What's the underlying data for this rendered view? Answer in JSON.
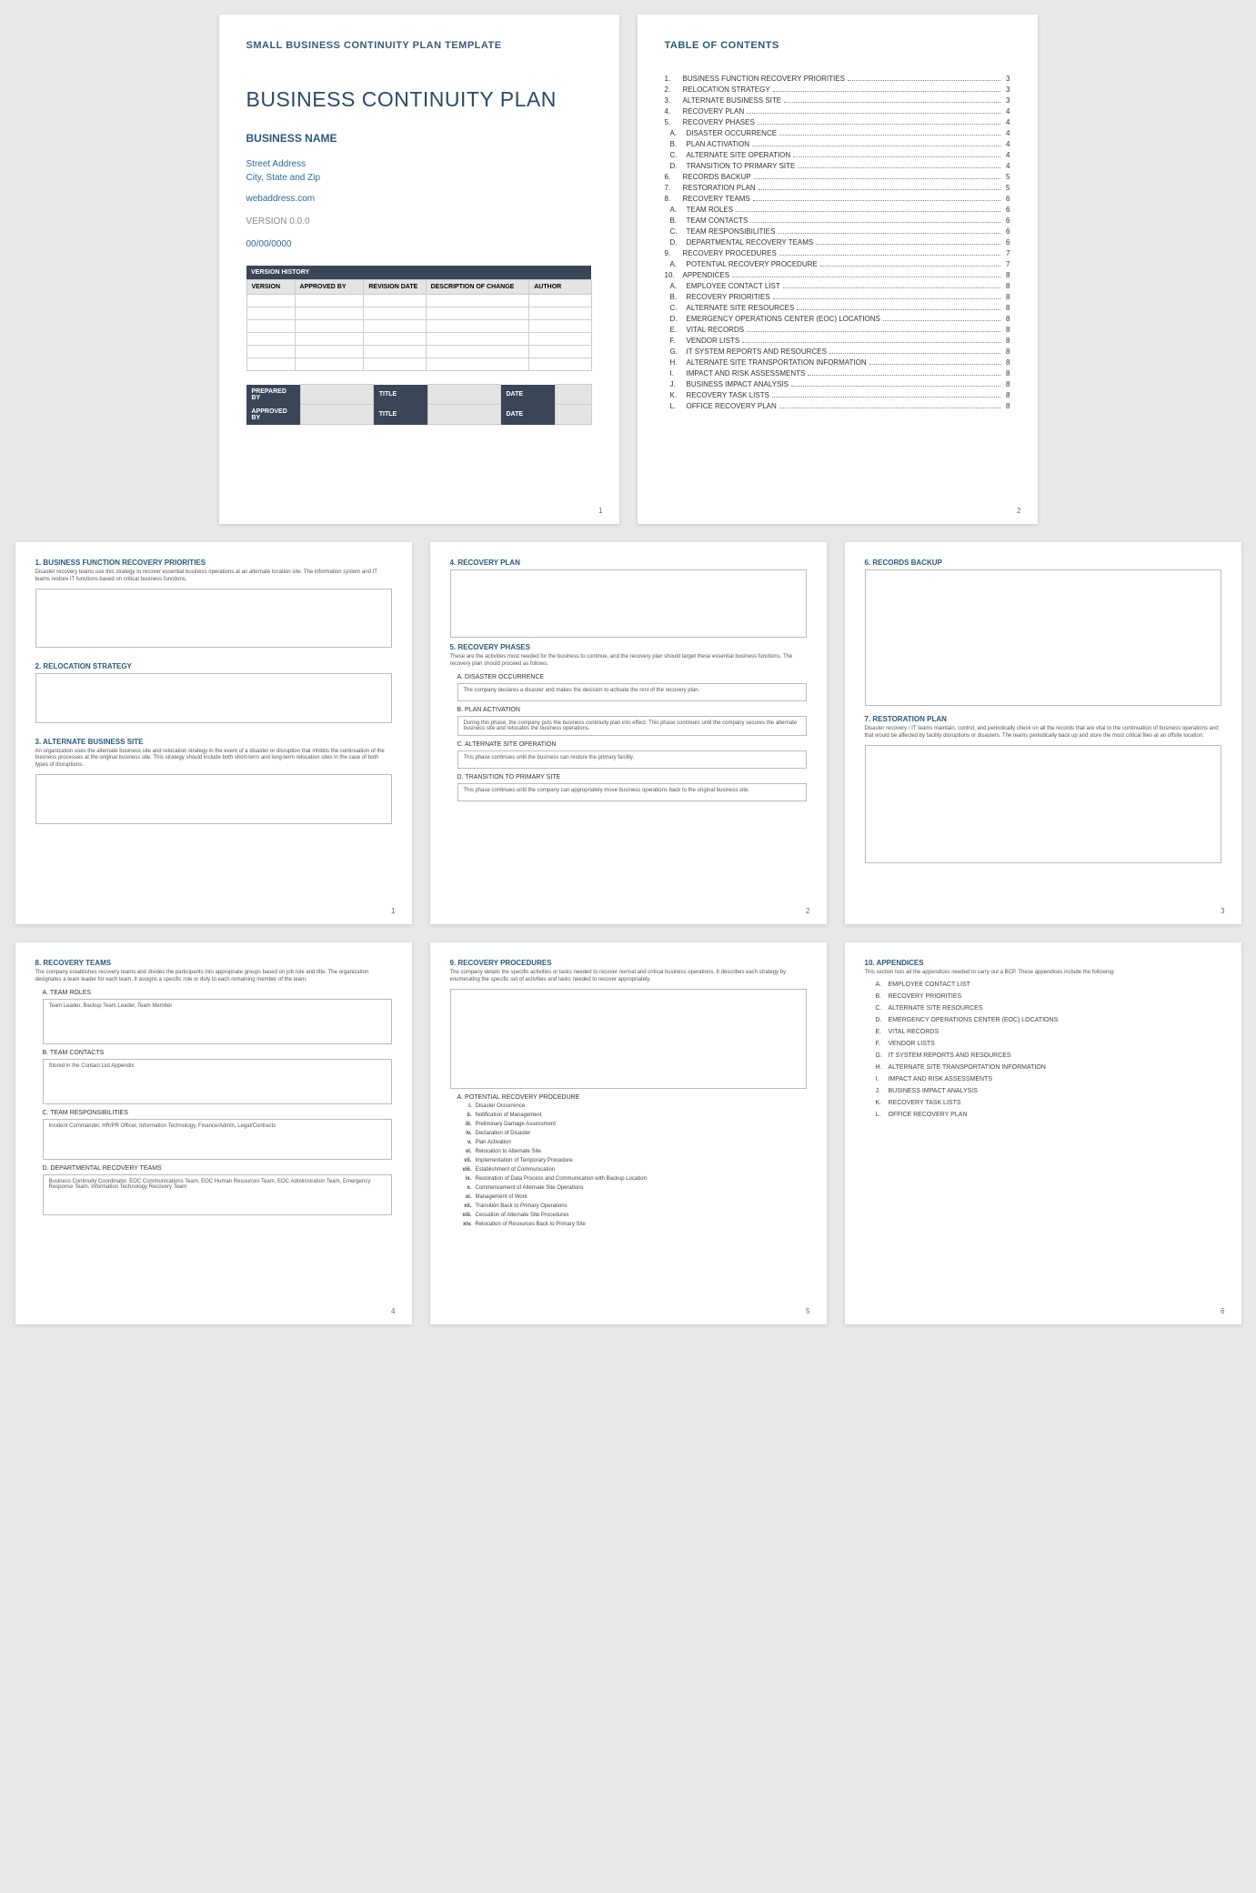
{
  "page1": {
    "template_title": "SMALL BUSINESS CONTINUITY PLAN TEMPLATE",
    "main_title": "BUSINESS CONTINUITY PLAN",
    "business_name": "BUSINESS NAME",
    "addr1": "Street Address",
    "addr2": "City, State and Zip",
    "web": "webaddress.com",
    "version": "VERSION 0.0.0",
    "date": "00/00/0000",
    "vh_title": "VERSION HISTORY",
    "vh_cols": {
      "c1": "VERSION",
      "c2": "APPROVED BY",
      "c3": "REVISION DATE",
      "c4": "DESCRIPTION OF CHANGE",
      "c5": "AUTHOR"
    },
    "sign": {
      "prepared": "PREPARED BY",
      "approved": "APPROVED BY",
      "title": "TITLE",
      "date": "DATE"
    },
    "pgnum": "1"
  },
  "page2": {
    "title": "TABLE OF CONTENTS",
    "items": [
      {
        "n": "1.",
        "t": "BUSINESS FUNCTION RECOVERY PRIORITIES",
        "p": "3"
      },
      {
        "n": "2.",
        "t": "RELOCATION STRATEGY",
        "p": "3"
      },
      {
        "n": "3.",
        "t": "ALTERNATE BUSINESS SITE",
        "p": "3"
      },
      {
        "n": "4.",
        "t": "RECOVERY PLAN",
        "p": "4"
      },
      {
        "n": "5.",
        "t": "RECOVERY PHASES",
        "p": "4"
      },
      {
        "n": "A.",
        "t": "DISASTER OCCURRENCE",
        "p": "4",
        "sub": true
      },
      {
        "n": "B.",
        "t": "PLAN ACTIVATION",
        "p": "4",
        "sub": true
      },
      {
        "n": "C.",
        "t": "ALTERNATE SITE OPERATION",
        "p": "4",
        "sub": true
      },
      {
        "n": "D.",
        "t": "TRANSITION TO PRIMARY SITE",
        "p": "4",
        "sub": true
      },
      {
        "n": "6.",
        "t": "RECORDS BACKUP",
        "p": "5"
      },
      {
        "n": "7.",
        "t": "RESTORATION PLAN",
        "p": "5"
      },
      {
        "n": "8.",
        "t": "RECOVERY TEAMS",
        "p": "6"
      },
      {
        "n": "A.",
        "t": "TEAM ROLES",
        "p": "6",
        "sub": true
      },
      {
        "n": "B.",
        "t": "TEAM CONTACTS",
        "p": "6",
        "sub": true
      },
      {
        "n": "C.",
        "t": "TEAM RESPONSIBILITIES",
        "p": "6",
        "sub": true
      },
      {
        "n": "D.",
        "t": "DEPARTMENTAL RECOVERY TEAMS",
        "p": "6",
        "sub": true
      },
      {
        "n": "9.",
        "t": "RECOVERY PROCEDURES",
        "p": "7"
      },
      {
        "n": "A.",
        "t": "POTENTIAL RECOVERY PROCEDURE",
        "p": "7",
        "sub": true
      },
      {
        "n": "10.",
        "t": "APPENDICES",
        "p": "8"
      },
      {
        "n": "A.",
        "t": "EMPLOYEE CONTACT LIST",
        "p": "8",
        "sub": true
      },
      {
        "n": "B.",
        "t": "RECOVERY PRIORITIES",
        "p": "8",
        "sub": true
      },
      {
        "n": "C.",
        "t": "ALTERNATE SITE RESOURCES",
        "p": "8",
        "sub": true
      },
      {
        "n": "D.",
        "t": "EMERGENCY OPERATIONS CENTER (EOC) LOCATIONS",
        "p": "8",
        "sub": true
      },
      {
        "n": "E.",
        "t": "VITAL RECORDS",
        "p": "8",
        "sub": true
      },
      {
        "n": "F.",
        "t": "VENDOR LISTS",
        "p": "8",
        "sub": true
      },
      {
        "n": "G.",
        "t": "IT SYSTEM REPORTS AND RESOURCES",
        "p": "8",
        "sub": true
      },
      {
        "n": "H.",
        "t": "ALTERNATE SITE TRANSPORTATION INFORMATION",
        "p": "8",
        "sub": true
      },
      {
        "n": "I.",
        "t": "IMPACT AND RISK ASSESSMENTS",
        "p": "8",
        "sub": true
      },
      {
        "n": "J.",
        "t": "BUSINESS IMPACT ANALYSIS",
        "p": "8",
        "sub": true
      },
      {
        "n": "K.",
        "t": "RECOVERY TASK LISTS",
        "p": "8",
        "sub": true
      },
      {
        "n": "L.",
        "t": "OFFICE RECOVERY PLAN",
        "p": "8",
        "sub": true
      }
    ],
    "pgnum": "2"
  },
  "page3": {
    "h1": "1. BUSINESS FUNCTION RECOVERY PRIORITIES",
    "p1": "Disaster recovery teams use this strategy to recover essential business operations at an alternate location site. The information system and IT teams restore IT functions based on critical business functions.",
    "h2": "2. RELOCATION STRATEGY",
    "h3": "3. ALTERNATE BUSINESS SITE",
    "p3": "An organization uses the alternate business site and relocation strategy in the event of a disaster or disruption that inhibits the continuation of the business processes at the original business site. This strategy should include both short-term and long-term relocation sites in the case of both types of disruptions.",
    "pgnum": "1"
  },
  "page4": {
    "h1": "4. RECOVERY PLAN",
    "h2": "5. RECOVERY PHASES",
    "p2": "These are the activities most needed for the business to continue, and the recovery plan should target these essential business functions. The recovery plan should proceed as follows:",
    "sA": "A. DISASTER OCCURRENCE",
    "tA": "The company declares a disaster and makes the decision to activate the rest of the recovery plan.",
    "sB": "B. PLAN ACTIVATION",
    "tB": "During this phase, the company puts the business continuity plan into effect. This phase continues until the company secures the alternate business site and relocates the business operations.",
    "sC": "C. ALTERNATE SITE OPERATION",
    "tC": "This phase continues until the business can restore the primary facility.",
    "sD": "D. TRANSITION TO PRIMARY SITE",
    "tD": "This phase continues until the company can appropriately move business operations back to the original business site.",
    "pgnum": "2"
  },
  "page5": {
    "h1": "6. RECORDS BACKUP",
    "h2": "7. RESTORATION PLAN",
    "p2": "Disaster recovery / IT teams maintain, control, and periodically check on all the records that are vital to the continuation of business operations and that would be affected by facility disruptions or disasters. The teams periodically back up and store the most critical files at an offsite location.",
    "pgnum": "3"
  },
  "page6": {
    "h1": "8. RECOVERY TEAMS",
    "p1": "The company establishes recovery teams and divides the participants into appropriate groups based on job role and title. The organization designates a team leader for each team. It assigns a specific role or duty to each remaining member of the team.",
    "sA": "A. TEAM ROLES",
    "tA": "Team Leader, Backup Team Leader, Team Member",
    "sB": "B. TEAM CONTACTS",
    "tB": "Stored in the Contact List Appendix",
    "sC": "C. TEAM RESPONSIBILITIES",
    "tC": "Incident Commander, HR/PR Officer, Information Technology, Finance/Admin, Legal/Contracts",
    "sD": "D. DEPARTMENTAL RECOVERY TEAMS",
    "tD": "Business Continuity Coordinator, EOC Communications Team, EOC Human Resources Team, EOC Administration Team, Emergency Response Team, Information Technology Recovery Team",
    "pgnum": "4"
  },
  "page7": {
    "h1": "9. RECOVERY PROCEDURES",
    "p1": "The company details the specific activities or tasks needed to recover normal and critical business operations. It describes each strategy by enumerating the specific set of activities and tasks needed to recover appropriately.",
    "sA": "A. POTENTIAL RECOVERY PROCEDURE",
    "steps": [
      {
        "r": "i.",
        "t": "Disaster Occurrence"
      },
      {
        "r": "ii.",
        "t": "Notification of Management"
      },
      {
        "r": "iii.",
        "t": "Preliminary Damage Assessment"
      },
      {
        "r": "iv.",
        "t": "Declaration of Disaster"
      },
      {
        "r": "v.",
        "t": "Plan Activation"
      },
      {
        "r": "vi.",
        "t": "Relocation to Alternate Site"
      },
      {
        "r": "vii.",
        "t": "Implementation of Temporary Procedure"
      },
      {
        "r": "viii.",
        "t": "Establishment of Communication"
      },
      {
        "r": "ix.",
        "t": "Restoration of Data Process and Communication with Backup Location"
      },
      {
        "r": "x.",
        "t": "Commencement of Alternate Site Operations"
      },
      {
        "r": "xi.",
        "t": "Management of Work"
      },
      {
        "r": "xii.",
        "t": "Transition Back to Primary Operations"
      },
      {
        "r": "xiii.",
        "t": "Cessation of Alternate Site Procedures"
      },
      {
        "r": "xiv.",
        "t": "Relocation of Resources Back to Primary Site"
      }
    ],
    "pgnum": "5"
  },
  "page8": {
    "h1": "10.   APPENDICES",
    "p1": "This section lists all the appendices needed to carry out a BCP. These appendices include the following:",
    "items": [
      {
        "l": "A.",
        "t": "EMPLOYEE CONTACT LIST"
      },
      {
        "l": "B.",
        "t": "RECOVERY PRIORITIES"
      },
      {
        "l": "C.",
        "t": "ALTERNATE SITE RESOURCES"
      },
      {
        "l": "D.",
        "t": "EMERGENCY OPERATIONS CENTER (EOC) LOCATIONS"
      },
      {
        "l": "E.",
        "t": "VITAL RECORDS"
      },
      {
        "l": "F.",
        "t": "VENDOR LISTS"
      },
      {
        "l": "G.",
        "t": "IT SYSTEM REPORTS AND RESOURCES"
      },
      {
        "l": "H.",
        "t": "ALTERNATE SITE TRANSPORTATION INFORMATION"
      },
      {
        "l": "I.",
        "t": "IMPACT AND RISK ASSESSMENTS"
      },
      {
        "l": "J.",
        "t": "BUSINESS IMPACT ANALYSIS"
      },
      {
        "l": "K.",
        "t": "RECOVERY TASK LISTS"
      },
      {
        "l": "L.",
        "t": "OFFICE RECOVERY PLAN"
      }
    ],
    "pgnum": "6"
  }
}
